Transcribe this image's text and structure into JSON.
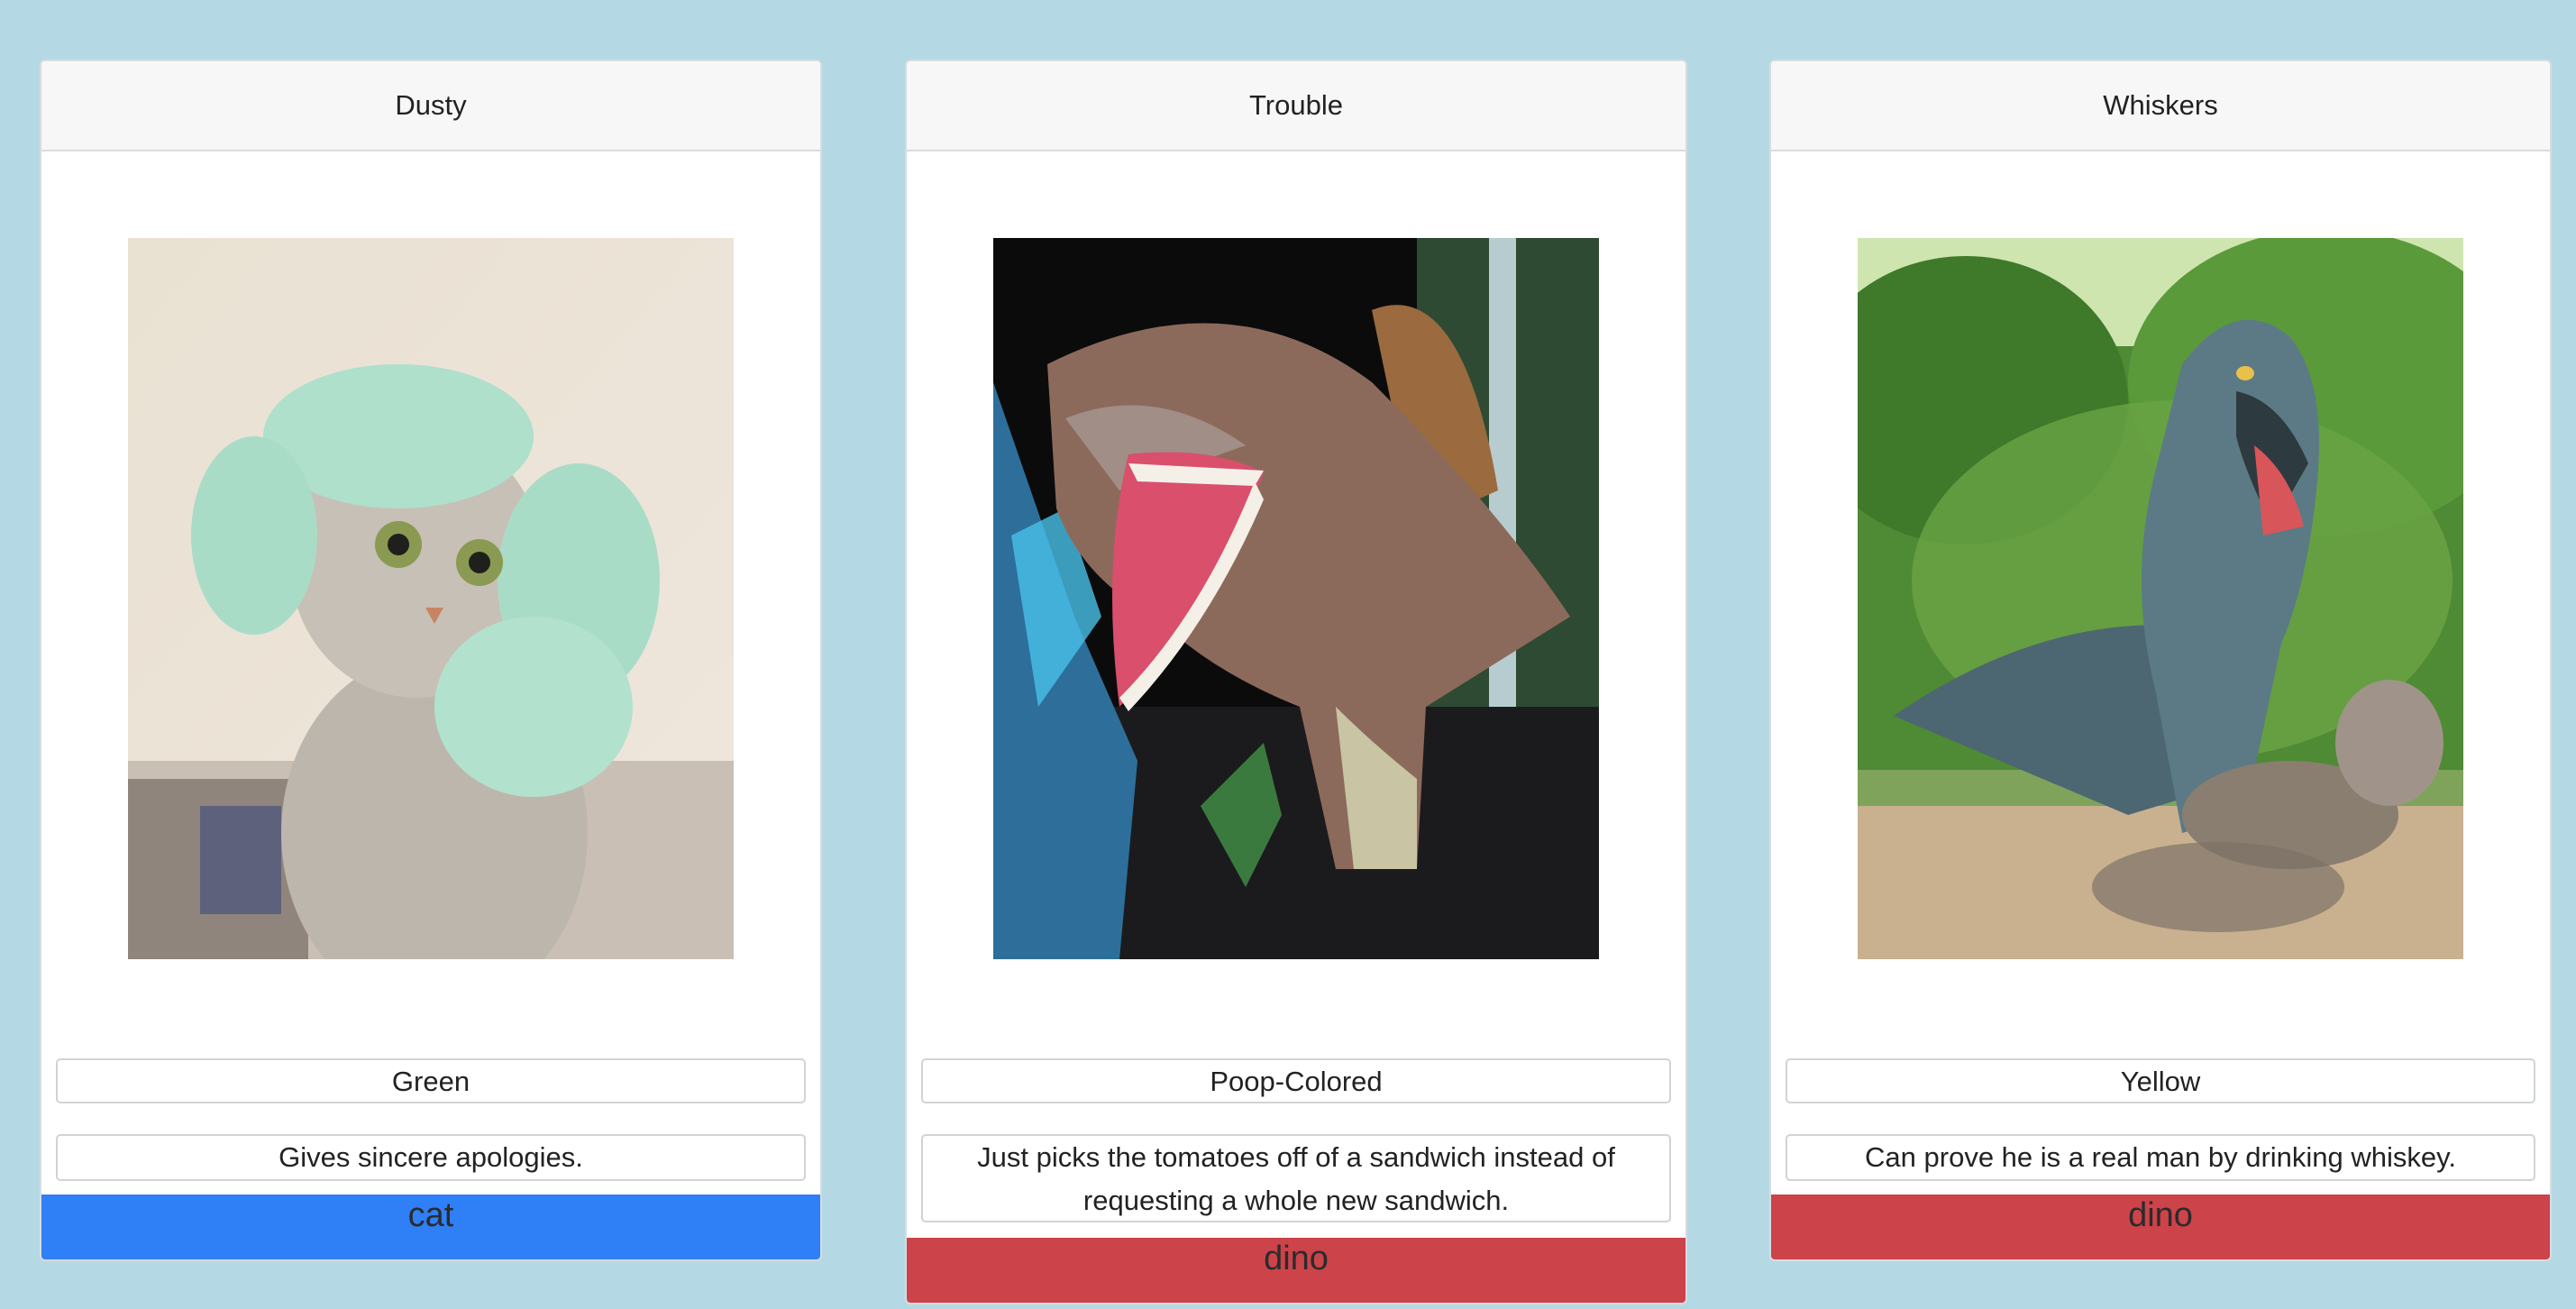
{
  "cards": [
    {
      "name": "Dusty",
      "color": "Green",
      "description": "Gives sincere apologies.",
      "type": "cat",
      "type_color": "#2f7ff6",
      "image_subject": "cat wearing mint towel hat"
    },
    {
      "name": "Trouble",
      "color": "Poop-Colored",
      "description": "Just picks the tomatoes off of a sandwich instead of requesting a whole new sandwich.",
      "type": "dino",
      "type_color": "#cc4349",
      "image_subject": "spinosaurus in cave"
    },
    {
      "name": "Whiskers",
      "color": "Yellow",
      "description": "Can prove he is a real man by drinking whiskey.",
      "type": "dino",
      "type_color": "#cc4349",
      "image_subject": "t-rex in forest"
    }
  ],
  "colors": {
    "background": "#b4d9e4",
    "cat_bar": "#2f7ff6",
    "dino_bar": "#cc4349"
  }
}
